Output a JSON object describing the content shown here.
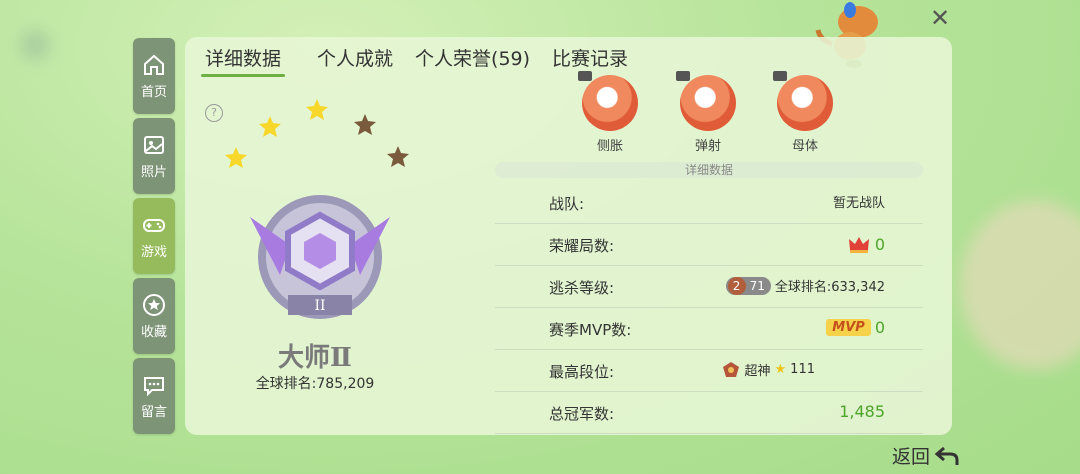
{
  "sidebar": {
    "items": [
      {
        "label": "首页",
        "icon": "home-icon"
      },
      {
        "label": "照片",
        "icon": "photo-icon"
      },
      {
        "label": "游戏",
        "icon": "gamepad-icon"
      },
      {
        "label": "收藏",
        "icon": "star-icon"
      },
      {
        "label": "留言",
        "icon": "message-icon"
      }
    ],
    "active_index": 2
  },
  "tabs": [
    {
      "label": "详细数据"
    },
    {
      "label": "个人成就"
    },
    {
      "label": "个人荣誉(59)"
    },
    {
      "label": "比赛记录"
    }
  ],
  "rank": {
    "name": "大师Ⅱ",
    "badge_numeral": "II",
    "global_rank": "全球排名:785,209",
    "stars_lit": 3,
    "stars_total": 5
  },
  "skills": [
    {
      "label": "侧胀"
    },
    {
      "label": "弹射"
    },
    {
      "label": "母体"
    }
  ],
  "section_title": "详细数据",
  "stats": {
    "team": {
      "label": "战队:",
      "value": "暂无战队"
    },
    "honor_games": {
      "label": "荣耀局数:",
      "value": "0"
    },
    "escape_level": {
      "label": "逃杀等级:",
      "coin": "2",
      "level": "71",
      "global_rank": "全球排名:633,342"
    },
    "season_mvp": {
      "label": "赛季MVP数:",
      "tag": "MVP",
      "value": "0"
    },
    "highest_tier": {
      "label": "最高段位:",
      "tier": "超神",
      "stars": "111"
    },
    "champions": {
      "label": "总冠军数:",
      "value": "1,485"
    }
  },
  "back_label": "返回",
  "colors": {
    "accent_green": "#4fa52c",
    "sidebar_active": "#96bb5c",
    "sidebar": "#7e9477"
  }
}
